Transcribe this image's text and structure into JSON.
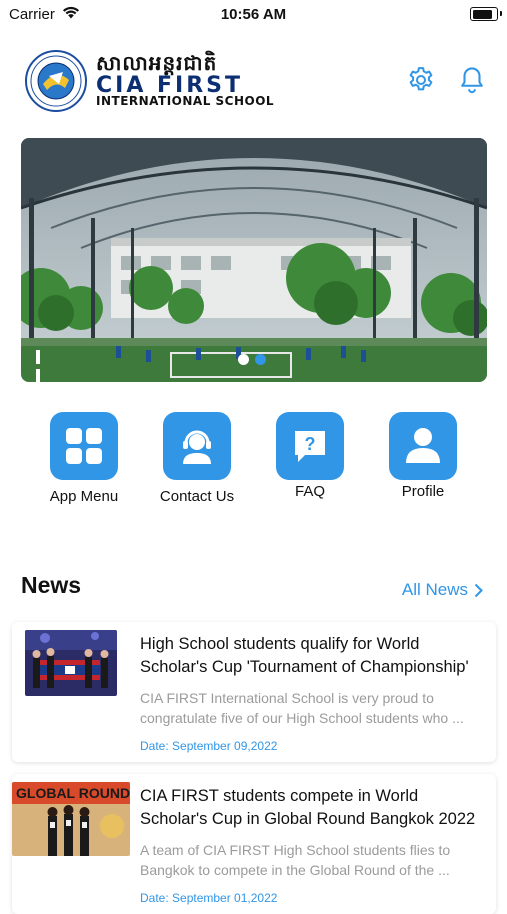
{
  "status_bar": {
    "carrier": "Carrier",
    "time": "10:56 AM"
  },
  "header": {
    "school_name_khmer": "សាលាអន្តរជាតិ",
    "school_name": "CIA FIRST",
    "school_subtitle": "INTERNATIONAL SCHOOL",
    "icons": [
      "settings-gear-icon",
      "notification-bell-icon"
    ]
  },
  "banner": {
    "slide_count": 2,
    "active_slide": 2
  },
  "quick_actions": [
    {
      "label": "App Menu",
      "icon": "grid-icon"
    },
    {
      "label": "Contact Us",
      "icon": "support-agent-icon"
    },
    {
      "label": "FAQ",
      "icon": "question-bubble-icon"
    },
    {
      "label": "Profile",
      "icon": "person-icon"
    }
  ],
  "news": {
    "title": "News",
    "all_news_label": "All News",
    "items": [
      {
        "title": "High School students qualify for World Scholar's Cup 'Tournament of Championship'",
        "summary": "CIA FIRST International School is very proud to congratulate five of our High School students who ...",
        "date": "Date: September 09,2022"
      },
      {
        "title": "CIA FIRST students compete in World Scholar's Cup in Global Round Bangkok 2022",
        "summary": "A team of CIA FIRST High School students flies to Bangkok to compete in the Global Round of the ...",
        "date": "Date: September 01,2022",
        "thumb_text": "GLOBAL ROUND"
      }
    ]
  },
  "colors": {
    "accent": "#3196e6",
    "brand_navy": "#0c2f73"
  }
}
